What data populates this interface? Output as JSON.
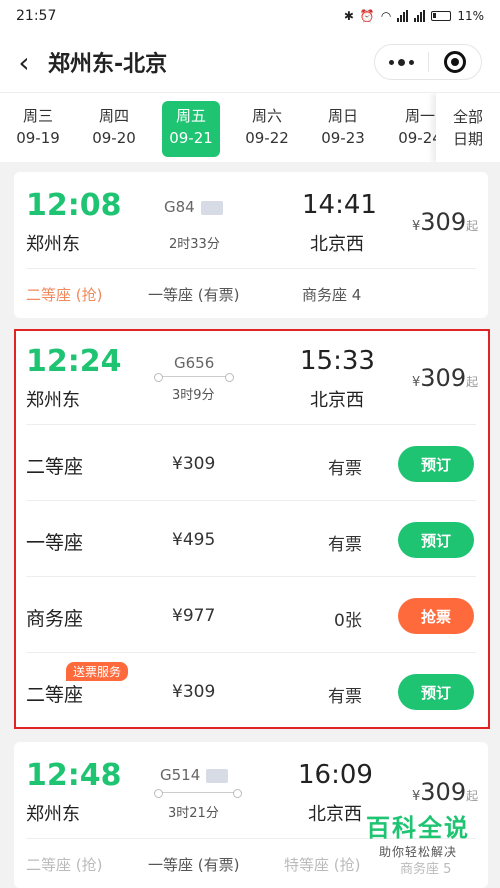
{
  "status_bar": {
    "time": "21:57",
    "battery": "11%"
  },
  "header": {
    "title": "郑州东-北京"
  },
  "dates": [
    {
      "weekday": "周三",
      "date": "09-19",
      "active": false
    },
    {
      "weekday": "周四",
      "date": "09-20",
      "active": false
    },
    {
      "weekday": "周五",
      "date": "09-21",
      "active": true
    },
    {
      "weekday": "周六",
      "date": "09-22",
      "active": false
    },
    {
      "weekday": "周日",
      "date": "09-23",
      "active": false
    },
    {
      "weekday": "周一",
      "date": "09-24",
      "active": false
    }
  ],
  "all_dates": {
    "line1": "全部",
    "line2": "日期"
  },
  "trains": [
    {
      "dep_time": "12:08",
      "dep_station": "郑州东",
      "train_no": "G84",
      "duration": "2时33分",
      "arr_time": "14:41",
      "arr_station": "北京西",
      "price": "309",
      "currency": "¥",
      "price_suffix": "起",
      "seats": [
        "二等座 (抢)",
        "一等座 (有票)",
        "商务座 4"
      ]
    },
    {
      "dep_time": "12:24",
      "dep_station": "郑州东",
      "train_no": "G656",
      "duration": "3时9分",
      "arr_time": "15:33",
      "arr_station": "北京西",
      "price": "309",
      "currency": "¥",
      "price_suffix": "起",
      "seat_rows": [
        {
          "name": "二等座",
          "price": "¥309",
          "availability": "有票",
          "action": "预订",
          "tag": ""
        },
        {
          "name": "一等座",
          "price": "¥495",
          "availability": "有票",
          "action": "预订",
          "tag": ""
        },
        {
          "name": "商务座",
          "price": "¥977",
          "availability": "0张",
          "action": "抢票",
          "tag": ""
        },
        {
          "name": "二等座",
          "price": "¥309",
          "availability": "有票",
          "action": "预订",
          "tag": "送票服务"
        }
      ]
    },
    {
      "dep_time": "12:48",
      "dep_station": "郑州东",
      "train_no": "G514",
      "duration": "3时21分",
      "arr_time": "16:09",
      "arr_station": "北京西",
      "price": "309",
      "currency": "¥",
      "price_suffix": "起",
      "seats": [
        "二等座 (抢)",
        "一等座 (有票)",
        "特等座 (抢)",
        "商务座 5"
      ]
    }
  ],
  "watermark": {
    "title": "百科全说",
    "subtitle": "助你轻松解决"
  },
  "colors": {
    "accent": "#1fc472",
    "warning": "#ff6a3c",
    "highlight_frame": "#e02424"
  }
}
